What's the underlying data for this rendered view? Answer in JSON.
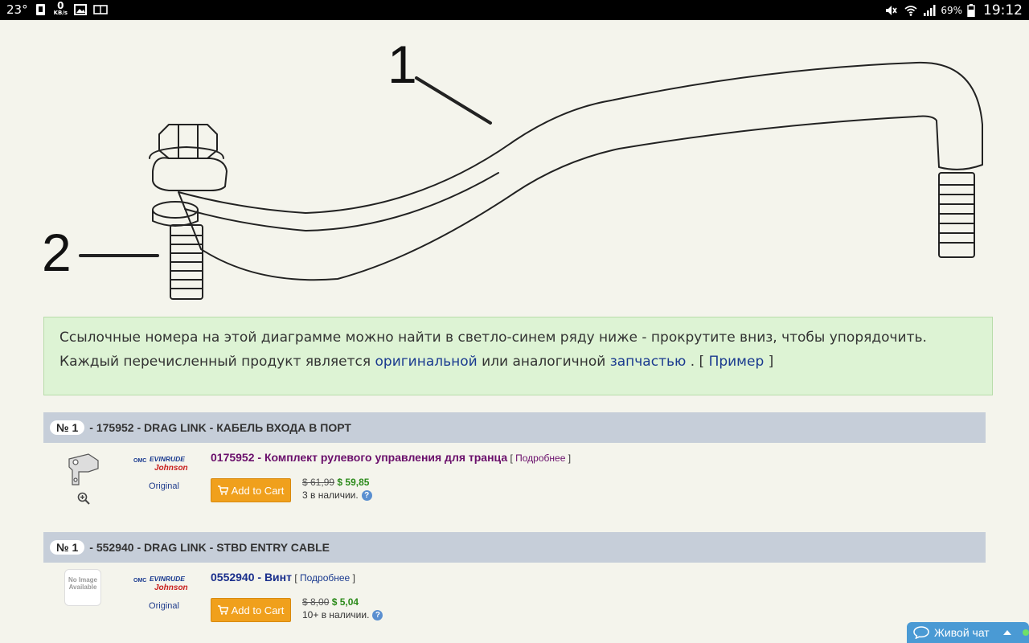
{
  "statusbar": {
    "temp": "23°",
    "kb_value": "0",
    "kb_unit": "KB/s",
    "battery": "69%",
    "time": "19:12"
  },
  "diagram": {
    "callout_1": "1",
    "callout_2": "2"
  },
  "info": {
    "line1": "Ссылочные номера на этой диаграмме можно найти в светло-синем ряду ниже - прокрутите вниз, чтобы упорядочить.",
    "line2_prefix": "Каждый перечисленный продукт является ",
    "link_original": "оригинальной",
    "line2_mid": " или аналогичной ",
    "link_part": "запчастью",
    "line2_after": " . [ ",
    "link_example": "Пример",
    "line2_end": " ]"
  },
  "sections": [
    {
      "ref": "№ 1",
      "title": " - 175952 - DRAG LINK - КАБЕЛЬ ВХОДА В ПОРТ",
      "product": {
        "brand_label": "Original",
        "name": "0175952 - Комплект рулевого управления для транца",
        "more_open": " [ ",
        "more": "Подробнее",
        "more_close": " ]",
        "cart": "Add to Cart",
        "old_price": "$ 61,99",
        "new_price": "$ 59,85",
        "stock": "3 в наличии."
      }
    },
    {
      "ref": "№ 1",
      "title": " - 552940 - DRAG LINK - STBD ENTRY CABLE",
      "product": {
        "brand_label": "Original",
        "name": "0552940 - Винт",
        "more_open": " [ ",
        "more": "Подробнее",
        "more_close": " ]",
        "cart": "Add to Cart",
        "old_price": "$ 8,00",
        "new_price": "$ 5,04",
        "stock": "10+ в наличии.",
        "noimage_line1": "No Image",
        "noimage_line2": "Available"
      }
    }
  ],
  "brand": {
    "omc": "OMC",
    "evinrude": "EVINRUDE",
    "johnson": "Johnson"
  },
  "chat": {
    "label": "Живой чат"
  },
  "colors": {
    "accent_orange": "#f0a01c",
    "header_bg": "#c6ced9",
    "info_bg": "#ddf3d4",
    "chat_bg": "#4a9ad4"
  }
}
